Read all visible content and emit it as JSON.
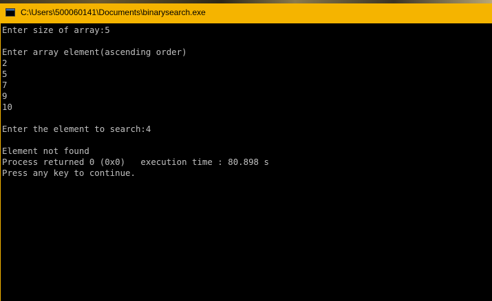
{
  "window": {
    "title": "C:\\Users\\500060141\\Documents\\binarysearch.exe",
    "icon": "console-app-icon",
    "titlebar_color": "#f5b400",
    "background_color": "#000000",
    "text_color": "#c0c0c0"
  },
  "console": {
    "lines": [
      "Enter size of array:5",
      "",
      "Enter array element(ascending order)",
      "2",
      "5",
      "7",
      "9",
      "10",
      "",
      "Enter the element to search:4",
      "",
      "Element not found",
      "Process returned 0 (0x0)   execution time : 80.898 s",
      "Press any key to continue."
    ]
  }
}
